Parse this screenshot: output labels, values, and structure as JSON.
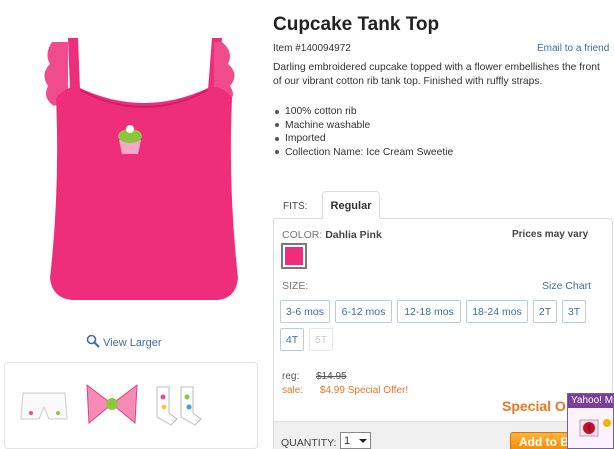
{
  "product": {
    "title": "Cupcake Tank Top",
    "item_number": "Item #140094972",
    "email_link": "Email to a friend",
    "description": "Darling embroidered cupcake topped with a flower embellishes the front of our vibrant cotton rib tank top. Finished with ruffly straps.",
    "features": [
      "100% cotton rib",
      "Machine washable",
      "Imported",
      "Collection Name: Ice Cream Sweetie"
    ],
    "view_larger": "View Larger"
  },
  "fits": {
    "label": "FITS:",
    "selected_tab": "Regular"
  },
  "color": {
    "label": "COLOR:",
    "value": "Dahlia Pink",
    "swatch_color": "#ee2d7b",
    "prices_note": "Prices may vary"
  },
  "size": {
    "label": "SIZE:",
    "chart_link": "Size Chart",
    "options": [
      "3-6 mos",
      "6-12 mos",
      "12-18 mos",
      "18-24 mos",
      "2T",
      "3T",
      "4T",
      "5T"
    ]
  },
  "pricing": {
    "reg_label": "reg:",
    "reg_price": "$14.95",
    "sale_label": "sale:",
    "sale_price": "$4.99 Special Offer!",
    "special_banner": "Special O"
  },
  "purchase": {
    "quantity_label": "QUANTITY:",
    "quantity_value": "1",
    "add_button": "Add to B"
  },
  "yahoo": {
    "title": "Yahoo! M"
  },
  "colors": {
    "link": "#3a6ea5",
    "accent_orange": "#e87722",
    "product_pink": "#ee2d7b",
    "yahoo_purple": "#7b3f9a"
  }
}
